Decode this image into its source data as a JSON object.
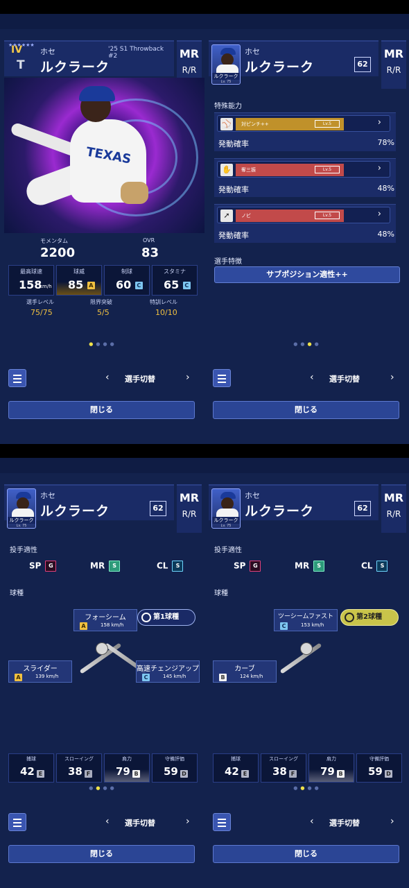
{
  "player": {
    "first_name": "ホセ",
    "last_name": "ルクラーク",
    "position": "MR",
    "handedness": "R/R",
    "rank": "IV",
    "team_letter": "T",
    "season": "'25 S1 Throwback #2",
    "level_box": "62",
    "portrait_name": "ルクラーク",
    "portrait_lv": "Lv. 75",
    "jersey_text": "TEXAS"
  },
  "overview": {
    "momentum_label": "モメンタム",
    "momentum_value": "2200",
    "ovr_label": "OVR",
    "ovr_value": "83",
    "stats": [
      {
        "label": "最高球速",
        "value": "158",
        "unit": "km/h",
        "grade": ""
      },
      {
        "label": "球威",
        "value": "85",
        "unit": "",
        "grade": "A"
      },
      {
        "label": "制球",
        "value": "60",
        "unit": "",
        "grade": "C"
      },
      {
        "label": "スタミナ",
        "value": "65",
        "unit": "",
        "grade": "C"
      }
    ],
    "levels": [
      {
        "label": "選手レベル",
        "value": "75/75"
      },
      {
        "label": "限界突破",
        "value": "5/5"
      },
      {
        "label": "特訓レベル",
        "value": "10/10"
      }
    ]
  },
  "abilities": {
    "title": "特殊能力",
    "items": [
      {
        "name": "対ピンチ++",
        "level": "Lv.5",
        "prob_label": "発動確率",
        "prob": "78%",
        "color": "#c0912a"
      },
      {
        "name": "奪三振",
        "level": "Lv.5",
        "prob_label": "発動確率",
        "prob": "48%",
        "color": "#c24a4a"
      },
      {
        "name": "ノビ",
        "level": "Lv.5",
        "prob_label": "発動確率",
        "prob": "48%",
        "color": "#c24a4a"
      }
    ],
    "trait_title": "選手特徴",
    "trait_button": "サブポジション適性++"
  },
  "aptitude": {
    "title": "投手適性",
    "positions": [
      {
        "pos": "SP",
        "grade": "G"
      },
      {
        "pos": "MR",
        "grade": "S"
      },
      {
        "pos": "CL",
        "grade": "S"
      }
    ],
    "pitch_title": "球種"
  },
  "pitches_primary": {
    "badge": "第1球種",
    "fastball": {
      "name": "フォーシーム",
      "grade": "A",
      "speed": "158 km/h"
    },
    "breaking": [
      {
        "name": "スライダー",
        "grade": "A",
        "speed": "139 km/h"
      },
      {
        "name": "高速チェンジアップ",
        "grade": "C",
        "speed": "145 km/h"
      }
    ]
  },
  "pitches_secondary": {
    "badge": "第2球種",
    "fastball": {
      "name": "ツーシームファスト",
      "grade": "C",
      "speed": "153 km/h"
    },
    "breaking": [
      {
        "name": "カーブ",
        "grade": "B",
        "speed": "124 km/h"
      }
    ]
  },
  "fielding": [
    {
      "label": "捕球",
      "value": "42",
      "grade": "E"
    },
    {
      "label": "スローイング",
      "value": "38",
      "grade": "F"
    },
    {
      "label": "肩力",
      "value": "79",
      "grade": "B"
    },
    {
      "label": "守備評価",
      "value": "59",
      "grade": "D"
    }
  ],
  "nav": {
    "switch_label": "選手切替",
    "prev": "‹",
    "next": "›",
    "close_label": "閉じる"
  },
  "pagination": {
    "panel1": 1,
    "panel2": 3,
    "panel3": 2,
    "panel4": 2,
    "count": 4
  },
  "colors": {
    "background": "#13224d",
    "accent_gold": "#f0c040",
    "skill_gold": "#c0912a",
    "skill_red": "#c24a4a"
  }
}
